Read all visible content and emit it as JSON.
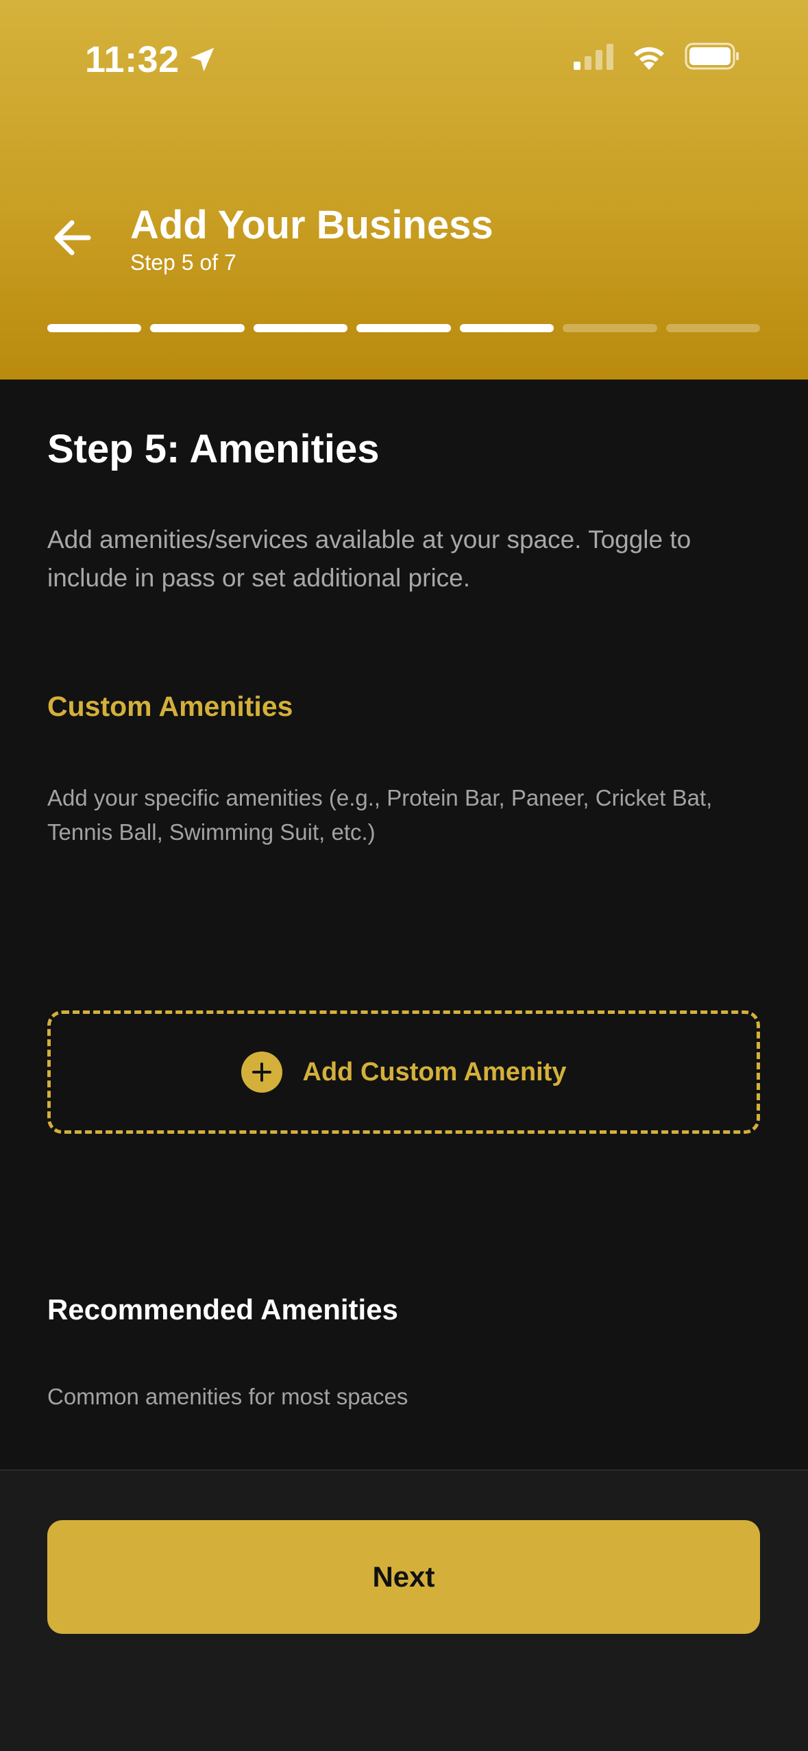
{
  "status_bar": {
    "time": "11:32"
  },
  "header": {
    "title": "Add Your Business",
    "step_label": "Step 5 of 7"
  },
  "progress": {
    "total_steps": 7,
    "current_step": 5
  },
  "main": {
    "step_heading": "Step 5: Amenities",
    "description": "Add amenities/services available at your space. Toggle to include in pass or set additional price.",
    "custom_amenities": {
      "title": "Custom Amenities",
      "description": "Add your specific amenities (e.g., Protein Bar, Paneer, Cricket Bat, Tennis Ball, Swimming Suit, etc.)",
      "add_button_label": "Add Custom Amenity"
    },
    "recommended_amenities": {
      "title": "Recommended Amenities",
      "description": "Common amenities for most spaces"
    }
  },
  "footer": {
    "next_label": "Next"
  },
  "colors": {
    "accent": "#d4b03b",
    "background": "#121212",
    "footer": "#1b1b1b"
  },
  "icons": [
    "location-arrow-icon",
    "cellular-signal-icon",
    "wifi-icon",
    "battery-icon",
    "back-arrow-icon",
    "plus-circle-icon"
  ]
}
